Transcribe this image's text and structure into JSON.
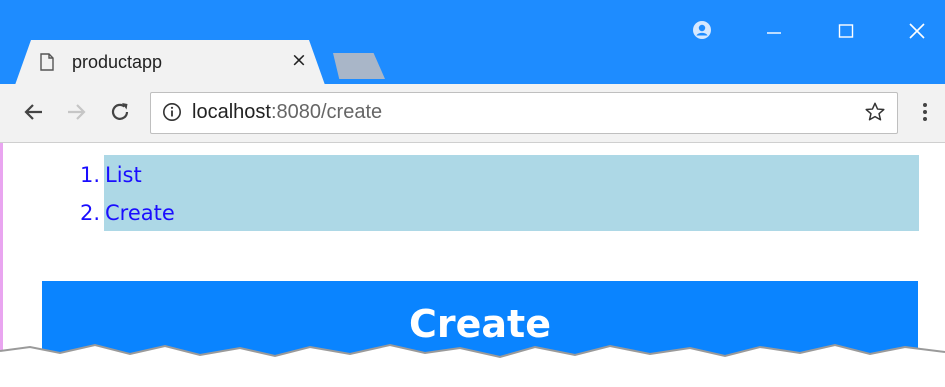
{
  "browser": {
    "tab": {
      "title": "productapp",
      "close_glyph": "×",
      "icon": "document-icon"
    },
    "new_tab_icon": "new-tab-icon",
    "window_controls": {
      "profile_icon": "profile-icon",
      "minimize_icon": "minimize-icon",
      "maximize_icon": "maximize-icon",
      "close_icon": "close-icon"
    },
    "toolbar": {
      "back_icon": "back-arrow-icon",
      "forward_icon": "forward-arrow-icon",
      "reload_icon": "reload-icon",
      "info_icon": "info-icon",
      "bookmark_icon": "star-icon",
      "menu_icon": "more-vert-icon"
    },
    "address": {
      "host": "localhost",
      "rest": ":8080/create"
    },
    "colors": {
      "titlebar": "#1e8cff",
      "toolbar": "#f2f2f2"
    }
  },
  "page": {
    "nav": {
      "items": [
        {
          "number": "1.",
          "label": "List"
        },
        {
          "number": "2.",
          "label": "Create"
        }
      ],
      "background": "#add8e6",
      "link_color": "#1a0dff"
    },
    "banner": {
      "text": "Create",
      "background": "#0a84ff"
    }
  }
}
